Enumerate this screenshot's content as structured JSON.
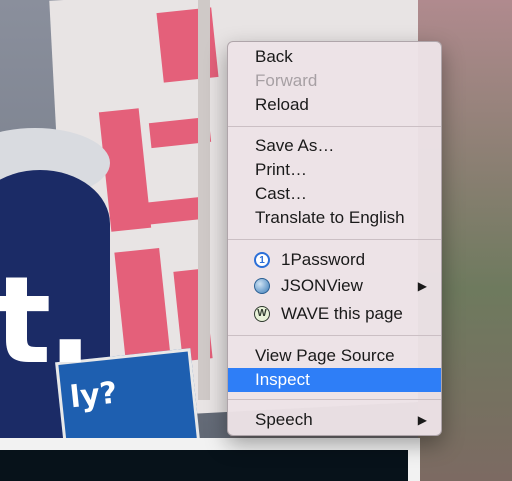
{
  "background": {
    "headline_fragment": "t.",
    "sign_text": "ly?"
  },
  "context_menu": {
    "groups": [
      {
        "items": [
          {
            "label": "Back",
            "enabled": true
          },
          {
            "label": "Forward",
            "enabled": false
          },
          {
            "label": "Reload",
            "enabled": true
          }
        ]
      },
      {
        "items": [
          {
            "label": "Save As…",
            "enabled": true
          },
          {
            "label": "Print…",
            "enabled": true
          },
          {
            "label": "Cast…",
            "enabled": true
          },
          {
            "label": "Translate to English",
            "enabled": true
          }
        ]
      },
      {
        "items": [
          {
            "label": "1Password",
            "icon": "1password-icon",
            "icon_text": "1",
            "enabled": true
          },
          {
            "label": "JSONView",
            "icon": "jsonview-icon",
            "submenu": true,
            "enabled": true
          },
          {
            "label": "WAVE this page",
            "icon": "wave-icon",
            "icon_text": "W",
            "enabled": true
          }
        ]
      },
      {
        "items": [
          {
            "label": "View Page Source",
            "enabled": true
          },
          {
            "label": "Inspect",
            "enabled": true,
            "selected": true
          }
        ]
      },
      {
        "items": [
          {
            "label": "Speech",
            "submenu": true,
            "enabled": true
          }
        ]
      }
    ],
    "submenu_arrow": "▶",
    "colors": {
      "menu_background": "#ece2e6",
      "selection": "#2e7ef7",
      "disabled_text": "#a7a0a4"
    }
  }
}
